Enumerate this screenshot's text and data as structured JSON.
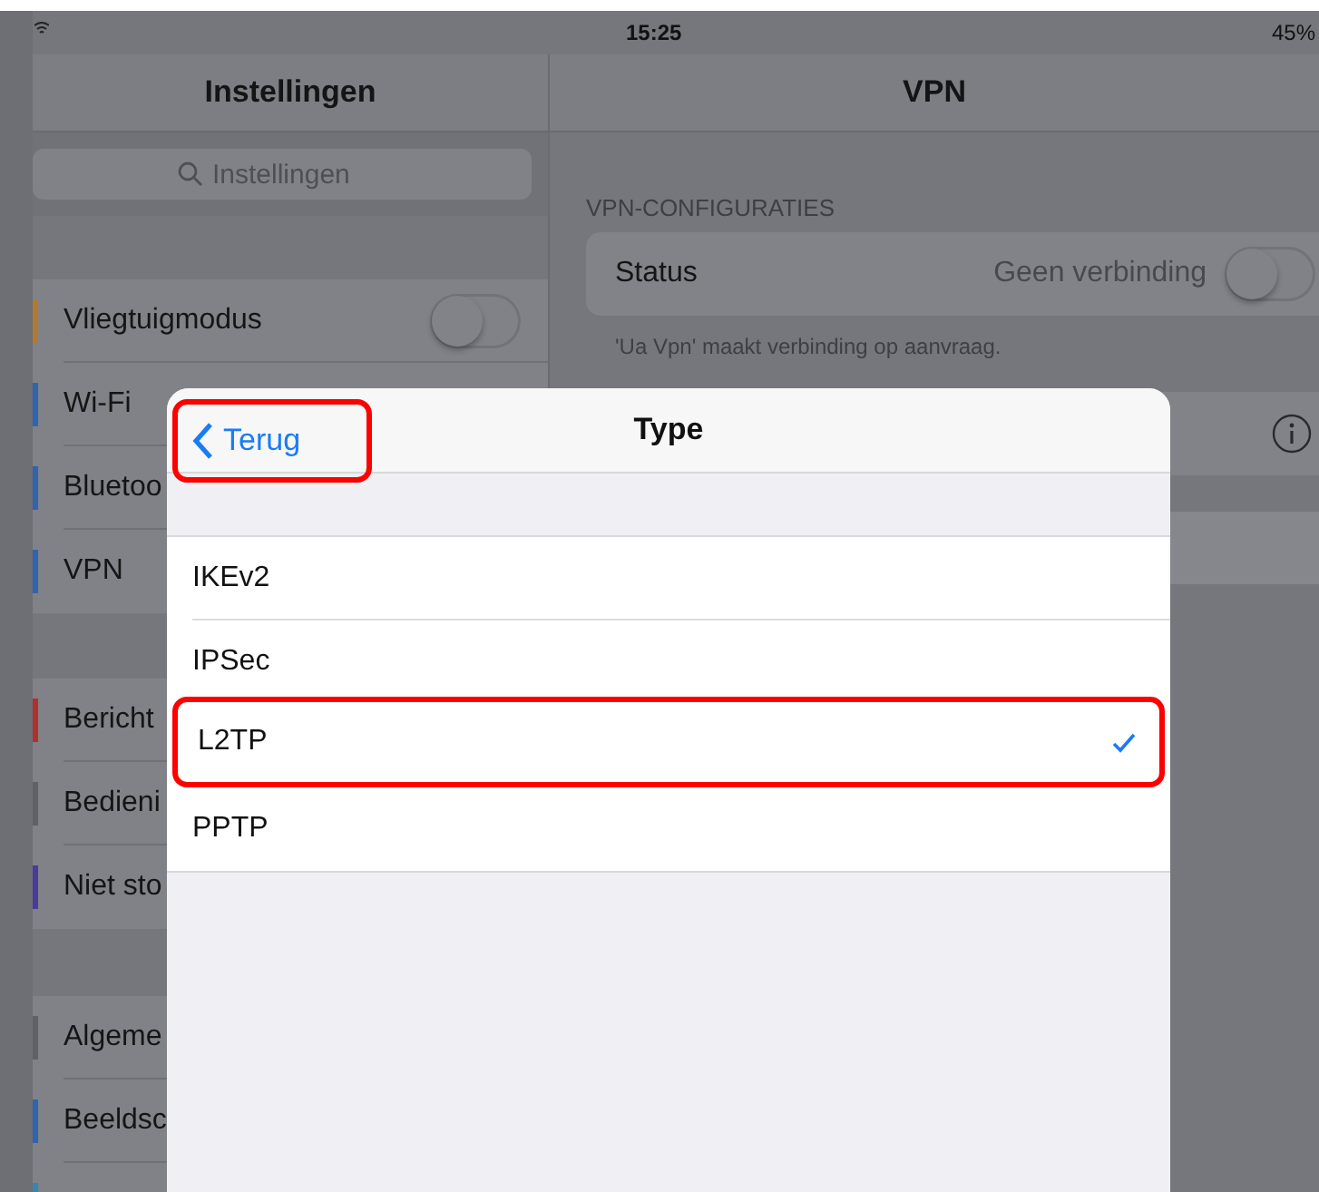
{
  "status_bar": {
    "time": "15:25",
    "battery": "45%"
  },
  "sidebar": {
    "title": "Instellingen",
    "search": {
      "placeholder": "Instellingen"
    },
    "groups": [
      [
        {
          "label": "Vliegtuigmodus",
          "color": "#b07a30",
          "kind": "toggle",
          "on": false
        },
        {
          "label": "Wi-Fi",
          "color": "#2f64b0",
          "kind": "link"
        },
        {
          "label": "Bluetoo",
          "color": "#2f64b0",
          "kind": "link"
        },
        {
          "label": "VPN",
          "color": "#2f64b0",
          "kind": "link"
        }
      ],
      [
        {
          "label": "Bericht",
          "color": "#b03030",
          "kind": "link"
        },
        {
          "label": "Bedieni",
          "color": "#606066",
          "kind": "link"
        },
        {
          "label": "Niet sto",
          "color": "#4a3aa0",
          "kind": "link"
        }
      ],
      [
        {
          "label": "Algeme",
          "color": "#606066",
          "kind": "link"
        },
        {
          "label": "Beeldsc",
          "color": "#2f64b0",
          "kind": "link"
        },
        {
          "color": "#2f8ab0",
          "kind": "link"
        }
      ]
    ]
  },
  "detail": {
    "title": "VPN",
    "section_header": "VPN-CONFIGURATIES",
    "status": {
      "label": "Status",
      "value": "Geen verbinding",
      "on": false
    },
    "footer": "'Ua Vpn' maakt verbinding op aanvraag."
  },
  "sheet": {
    "back": {
      "label": "Terug",
      "highlighted": true
    },
    "title": "Type",
    "options": [
      {
        "label": "IKEv2",
        "selected": false,
        "highlighted": false
      },
      {
        "label": "IPSec",
        "selected": false,
        "highlighted": false
      },
      {
        "label": "L2TP",
        "selected": true,
        "highlighted": true
      },
      {
        "label": "PPTP",
        "selected": false,
        "highlighted": false
      }
    ]
  }
}
